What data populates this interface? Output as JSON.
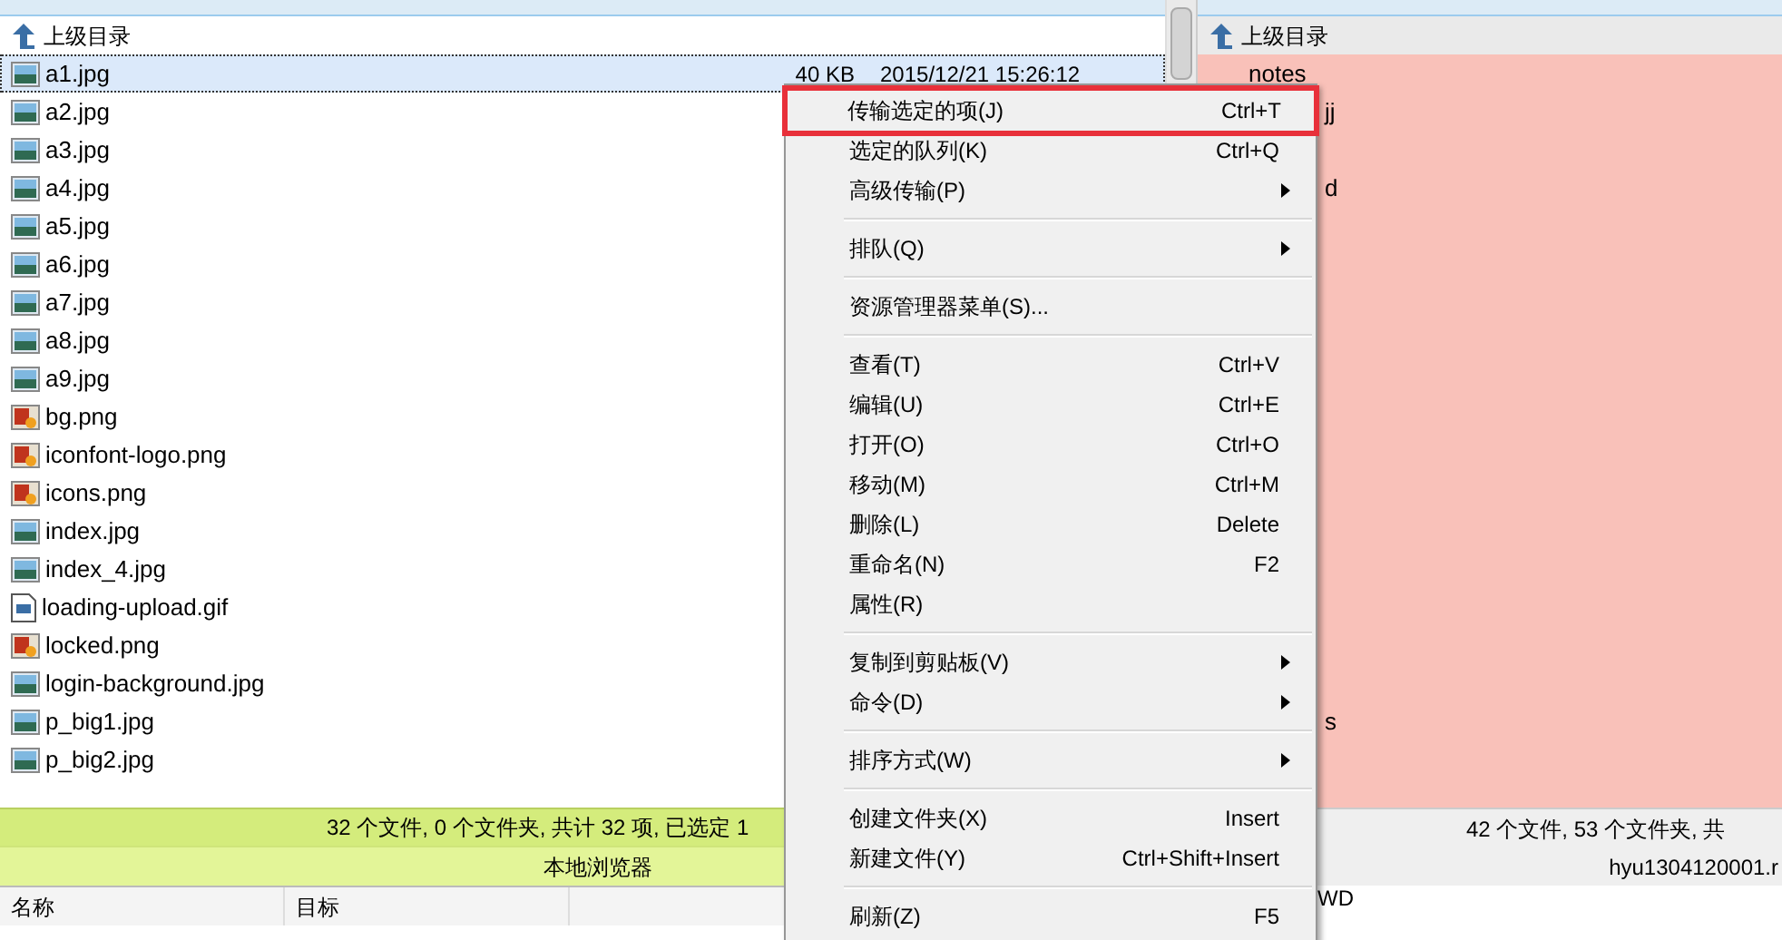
{
  "local_pane": {
    "parent_row": {
      "label": "上级目录"
    },
    "files": [
      {
        "name": "a1.jpg",
        "kind": "jpg",
        "size": "40 KB",
        "modified": "2015/12/21 15:26:12",
        "selected": true
      },
      {
        "name": "a2.jpg",
        "kind": "jpg",
        "selected": false
      },
      {
        "name": "a3.jpg",
        "kind": "jpg",
        "selected": false
      },
      {
        "name": "a4.jpg",
        "kind": "jpg",
        "selected": false
      },
      {
        "name": "a5.jpg",
        "kind": "jpg",
        "selected": false
      },
      {
        "name": "a6.jpg",
        "kind": "jpg",
        "selected": false
      },
      {
        "name": "a7.jpg",
        "kind": "jpg",
        "selected": false
      },
      {
        "name": "a8.jpg",
        "kind": "jpg",
        "selected": false
      },
      {
        "name": "a9.jpg",
        "kind": "jpg",
        "selected": false
      },
      {
        "name": "bg.png",
        "kind": "png",
        "selected": false
      },
      {
        "name": "iconfont-logo.png",
        "kind": "png",
        "selected": false
      },
      {
        "name": "icons.png",
        "kind": "png",
        "selected": false
      },
      {
        "name": "index.jpg",
        "kind": "jpg",
        "selected": false
      },
      {
        "name": "index_4.jpg",
        "kind": "jpg",
        "selected": false
      },
      {
        "name": "loading-upload.gif",
        "kind": "gif",
        "selected": false
      },
      {
        "name": "locked.png",
        "kind": "png",
        "selected": false
      },
      {
        "name": "login-background.jpg",
        "kind": "jpg",
        "selected": false
      },
      {
        "name": "p_big1.jpg",
        "kind": "jpg",
        "selected": false
      },
      {
        "name": "p_big2.jpg",
        "kind": "jpg",
        "selected": false
      }
    ],
    "status": "32 个文件, 0 个文件夹, 共计 32 项, 已选定 1",
    "title": "本地浏览器"
  },
  "queue_columns": [
    "名称",
    "目标"
  ],
  "remote_pane": {
    "parent_row": {
      "label": "上级目录"
    },
    "fragments": [
      "notes",
      "jj",
      "d",
      "s"
    ],
    "status": "42 个文件, 53 个文件夹, 共",
    "title": "hyu1304120001.r"
  },
  "log_lines": [
    "WD"
  ],
  "context_menu": [
    {
      "kind": "item",
      "label": "传输选定的项(J)",
      "shortcut": "Ctrl+T",
      "submenu": false,
      "outlined": true
    },
    {
      "kind": "item",
      "label": "选定的队列(K)",
      "shortcut": "Ctrl+Q",
      "submenu": false,
      "outlined": false
    },
    {
      "kind": "item",
      "label": "高级传输(P)",
      "submenu": true,
      "outlined": false
    },
    {
      "kind": "separator"
    },
    {
      "kind": "item",
      "label": "排队(Q)",
      "submenu": true,
      "outlined": false
    },
    {
      "kind": "separator"
    },
    {
      "kind": "item",
      "label": "资源管理器菜单(S)...",
      "submenu": false,
      "outlined": false
    },
    {
      "kind": "separator"
    },
    {
      "kind": "item",
      "label": "查看(T)",
      "shortcut": "Ctrl+V",
      "submenu": false,
      "outlined": false
    },
    {
      "kind": "item",
      "label": "编辑(U)",
      "shortcut": "Ctrl+E",
      "submenu": false,
      "outlined": false
    },
    {
      "kind": "item",
      "label": "打开(O)",
      "shortcut": "Ctrl+O",
      "submenu": false,
      "outlined": false
    },
    {
      "kind": "item",
      "label": "移动(M)",
      "shortcut": "Ctrl+M",
      "submenu": false,
      "outlined": false
    },
    {
      "kind": "item",
      "label": "删除(L)",
      "shortcut": "Delete",
      "submenu": false,
      "outlined": false
    },
    {
      "kind": "item",
      "label": "重命名(N)",
      "shortcut": "F2",
      "submenu": false,
      "outlined": false
    },
    {
      "kind": "item",
      "label": "属性(R)",
      "submenu": false,
      "outlined": false
    },
    {
      "kind": "separator"
    },
    {
      "kind": "item",
      "label": "复制到剪贴板(V)",
      "submenu": true,
      "outlined": false
    },
    {
      "kind": "item",
      "label": "命令(D)",
      "submenu": true,
      "outlined": false
    },
    {
      "kind": "separator"
    },
    {
      "kind": "item",
      "label": "排序方式(W)",
      "submenu": true,
      "outlined": false
    },
    {
      "kind": "separator"
    },
    {
      "kind": "item",
      "label": "创建文件夹(X)",
      "shortcut": "Insert",
      "submenu": false,
      "outlined": false
    },
    {
      "kind": "item",
      "label": "新建文件(Y)",
      "shortcut": "Ctrl+Shift+Insert",
      "submenu": false,
      "outlined": false
    },
    {
      "kind": "separator"
    },
    {
      "kind": "item",
      "label": "刷新(Z)",
      "shortcut": "F5",
      "submenu": false,
      "outlined": false
    }
  ]
}
